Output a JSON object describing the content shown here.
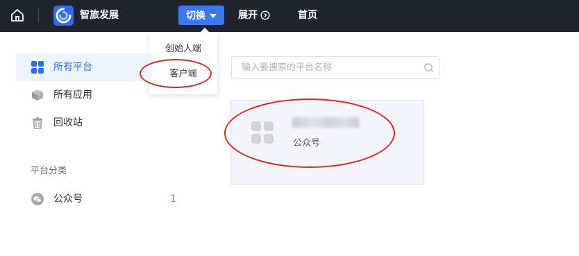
{
  "app": {
    "brand": "智旅发展",
    "colors": {
      "topbar": "#1f242d",
      "accent": "#2f6bf5",
      "annotation": "#e0241c"
    }
  },
  "topbar": {
    "home_icon": "home-icon",
    "switch_label": "切换",
    "expand_label": "展开",
    "home_label": "首页"
  },
  "dropdown": {
    "items": [
      {
        "label": "创始人端"
      },
      {
        "label": "客户端"
      }
    ]
  },
  "sidebar": {
    "items": [
      {
        "label": "所有平台",
        "icon": "grid-icon",
        "active": true
      },
      {
        "label": "所有应用",
        "icon": "cube-icon"
      },
      {
        "label": "回收站",
        "icon": "trash-icon"
      }
    ],
    "section_title": "平台分类",
    "categories": [
      {
        "label": "公众号",
        "icon": "wechat-icon",
        "count": "1"
      }
    ]
  },
  "search": {
    "placeholder": "输入要搜索的平台名称",
    "value": ""
  },
  "cards": [
    {
      "type_label": "公众号",
      "icon": "app-grid-icon",
      "name_blurred": true
    }
  ]
}
